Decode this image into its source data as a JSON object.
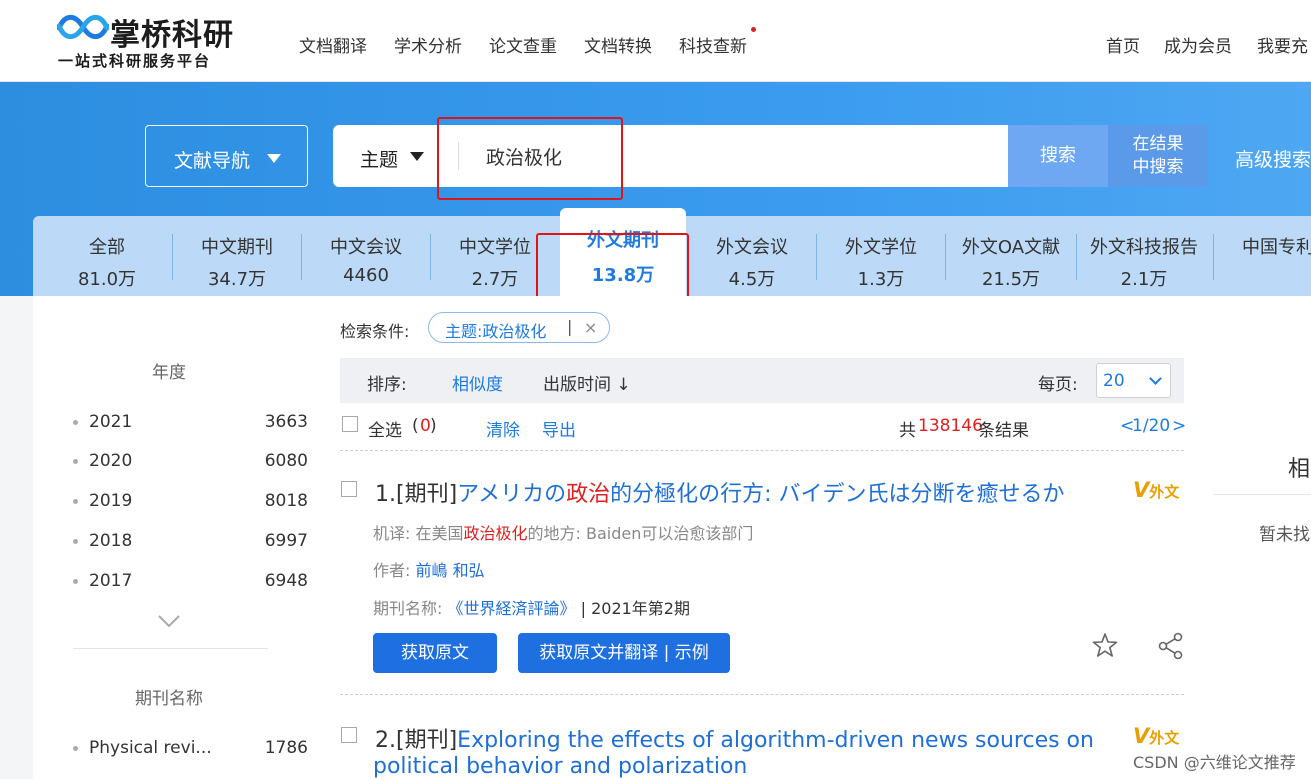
{
  "brand": {
    "title": "掌桥科研",
    "subtitle": "一站式科研服务平台",
    "accent": "#1e7be0"
  },
  "nav": {
    "items": [
      "文档翻译",
      "学术分析",
      "论文查重",
      "文档转换",
      "科技查新"
    ],
    "right": [
      "首页",
      "成为会员",
      "我要充"
    ]
  },
  "search": {
    "lib_nav": "文献导航",
    "field": "主题",
    "query": "政治极化",
    "search_label": "搜索",
    "within_label_1": "在结果",
    "within_label_2": "中搜索",
    "advanced": "高级搜索"
  },
  "tabs": [
    {
      "label": "全部",
      "count": "81.0万"
    },
    {
      "label": "中文期刊",
      "count": "34.7万"
    },
    {
      "label": "中文会议",
      "count": "4460"
    },
    {
      "label": "中文学位",
      "count": "2.7万"
    },
    {
      "label": "外文期刊",
      "count": "13.8万"
    },
    {
      "label": "外文会议",
      "count": "4.5万"
    },
    {
      "label": "外文学位",
      "count": "1.3万"
    },
    {
      "label": "外文OA文献",
      "count": "21.5万"
    },
    {
      "label": "外文科技报告",
      "count": "2.1万"
    },
    {
      "label": "中国专利",
      "count": ""
    }
  ],
  "sidebar": {
    "year_heading": "年度",
    "years": [
      {
        "year": "2021",
        "count": "3663"
      },
      {
        "year": "2020",
        "count": "6080"
      },
      {
        "year": "2019",
        "count": "8018"
      },
      {
        "year": "2018",
        "count": "6997"
      },
      {
        "year": "2017",
        "count": "6948"
      }
    ],
    "journal_heading": "期刊名称",
    "journals": [
      {
        "name": "Physical revi...",
        "count": "1786"
      }
    ]
  },
  "conditions": {
    "label": "检索条件:",
    "tag": "主题:政治极化",
    "remove": "×"
  },
  "sort": {
    "label": "排序:",
    "relevance": "相似度",
    "date": "出版时间 ↓",
    "per_page_label": "每页:",
    "per_page": "20"
  },
  "selection": {
    "select_all": "全选",
    "open": "(",
    "count": "0",
    "close": ")",
    "clear": "清除",
    "export": "导出",
    "total_prefix": "共",
    "total": "138146",
    "total_suffix": "条结果",
    "pager_prev": "<",
    "pager": "1/20",
    "pager_next": ">"
  },
  "results": [
    {
      "index": "1.[期刊]",
      "title_a": "アメリカの",
      "title_hl": "政治",
      "title_b": "的分極化の行方: バイデン氏は分断を癒せるか",
      "badge": "外文",
      "trans_label": "机译:",
      "trans_a": "在美国",
      "trans_hl": "政治极化",
      "trans_b": "的地方: Baiden可以治愈该部门",
      "author_label": "作者:",
      "author": "前嶋 和弘",
      "journal_label": "期刊名称:",
      "journal": "《世界経済評論》",
      "issue": " | 2021年第2期",
      "btn_get": "获取原文",
      "btn_translate": "获取原文并翻译 | 示例"
    },
    {
      "index": "2.[期刊]",
      "title_line1": "Exploring the effects of algorithm-driven news sources on",
      "title_line2": "political behavior and polarization",
      "badge": "外文"
    }
  ],
  "right_panel": {
    "heading": "相",
    "empty": "暂未找"
  },
  "watermark": "CSDN @六维论文推荐",
  "icons": [
    "logo-wave-icon",
    "caret-down-icon",
    "chevron-down-icon",
    "close-icon",
    "star-icon",
    "share-icon"
  ]
}
